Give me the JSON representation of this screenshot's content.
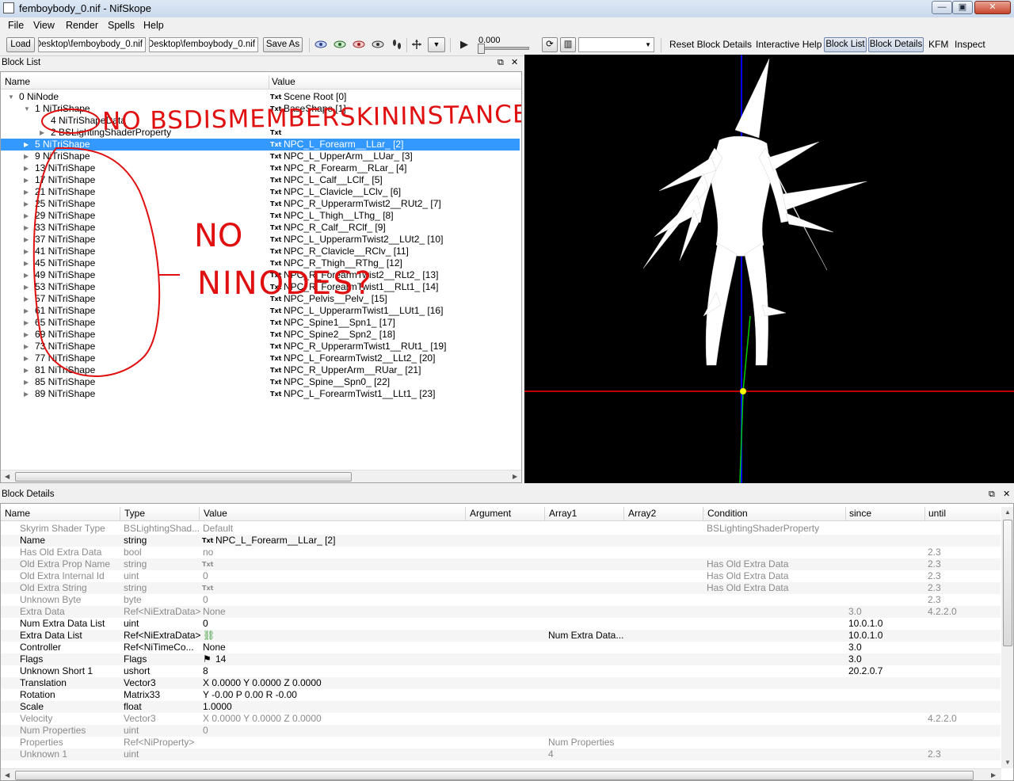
{
  "window": {
    "title": "femboybody_0.nif - NifSkope",
    "min_glyph": "—",
    "max_glyph": "▣",
    "close_glyph": "✕"
  },
  "menu": [
    "File",
    "View",
    "Render",
    "Spells",
    "Help"
  ],
  "toolbar": {
    "load_label": "Load",
    "load_path": "Desktop\\femboybody_0.nif",
    "save_path": "Desktop\\femboybody_0.nif",
    "save_as_label": "Save As",
    "view_icons": [
      "eye-icon",
      "eye-green-icon",
      "eye-red-icon",
      "eye-dark-icon",
      "eye-closed-icon",
      "footprints-icon"
    ],
    "play_glyph": "▶",
    "time_value": "0.000",
    "anim_select_value": "",
    "reset_label": "Reset Block Details",
    "help_label": "Interactive Help",
    "block_list_label": "Block List",
    "block_details_label": "Block Details",
    "kfm_label": "KFM",
    "inspect_label": "Inspect"
  },
  "block_list": {
    "title": "Block List",
    "col_name": "Name",
    "col_value": "Value",
    "txt_tag": "Txt",
    "rows": [
      {
        "indent": 0,
        "expanded": true,
        "name": "0 NiNode",
        "value": "Scene Root [0]",
        "txt": true,
        "selected": false
      },
      {
        "indent": 1,
        "expanded": true,
        "name": "1 NiTriShape",
        "value": "BaseShape [1]",
        "txt": true,
        "selected": false
      },
      {
        "indent": 2,
        "expanded": null,
        "name": "4 NiTriShapeData",
        "value": "",
        "txt": false,
        "selected": false
      },
      {
        "indent": 2,
        "expanded": false,
        "name": "2 BSLightingShaderProperty",
        "value": "",
        "txt": true,
        "selected": false
      },
      {
        "indent": 1,
        "expanded": false,
        "name": "5 NiTriShape",
        "value": "NPC_L_Forearm__LLar_ [2]",
        "txt": true,
        "selected": true
      },
      {
        "indent": 1,
        "expanded": false,
        "name": "9 NiTriShape",
        "value": "NPC_L_UpperArm__LUar_ [3]",
        "txt": true,
        "selected": false
      },
      {
        "indent": 1,
        "expanded": false,
        "name": "13 NiTriShape",
        "value": "NPC_R_Forearm__RLar_ [4]",
        "txt": true,
        "selected": false
      },
      {
        "indent": 1,
        "expanded": false,
        "name": "17 NiTriShape",
        "value": "NPC_L_Calf__LClf_ [5]",
        "txt": true,
        "selected": false
      },
      {
        "indent": 1,
        "expanded": false,
        "name": "21 NiTriShape",
        "value": "NPC_L_Clavicle__LClv_ [6]",
        "txt": true,
        "selected": false
      },
      {
        "indent": 1,
        "expanded": false,
        "name": "25 NiTriShape",
        "value": "NPC_R_UpperarmTwist2__RUt2_ [7]",
        "txt": true,
        "selected": false
      },
      {
        "indent": 1,
        "expanded": false,
        "name": "29 NiTriShape",
        "value": "NPC_L_Thigh__LThg_ [8]",
        "txt": true,
        "selected": false
      },
      {
        "indent": 1,
        "expanded": false,
        "name": "33 NiTriShape",
        "value": "NPC_R_Calf__RClf_ [9]",
        "txt": true,
        "selected": false
      },
      {
        "indent": 1,
        "expanded": false,
        "name": "37 NiTriShape",
        "value": "NPC_L_UpperarmTwist2__LUt2_ [10]",
        "txt": true,
        "selected": false
      },
      {
        "indent": 1,
        "expanded": false,
        "name": "41 NiTriShape",
        "value": "NPC_R_Clavicle__RClv_ [11]",
        "txt": true,
        "selected": false
      },
      {
        "indent": 1,
        "expanded": false,
        "name": "45 NiTriShape",
        "value": "NPC_R_Thigh__RThg_ [12]",
        "txt": true,
        "selected": false
      },
      {
        "indent": 1,
        "expanded": false,
        "name": "49 NiTriShape",
        "value": "NPC_R_ForearmTwist2__RLt2_ [13]",
        "txt": true,
        "selected": false
      },
      {
        "indent": 1,
        "expanded": false,
        "name": "53 NiTriShape",
        "value": "NPC_R_ForearmTwist1__RLt1_ [14]",
        "txt": true,
        "selected": false
      },
      {
        "indent": 1,
        "expanded": false,
        "name": "57 NiTriShape",
        "value": "NPC_Pelvis__Pelv_ [15]",
        "txt": true,
        "selected": false
      },
      {
        "indent": 1,
        "expanded": false,
        "name": "61 NiTriShape",
        "value": "NPC_L_UpperarmTwist1__LUt1_ [16]",
        "txt": true,
        "selected": false
      },
      {
        "indent": 1,
        "expanded": false,
        "name": "65 NiTriShape",
        "value": "NPC_Spine1__Spn1_ [17]",
        "txt": true,
        "selected": false
      },
      {
        "indent": 1,
        "expanded": false,
        "name": "69 NiTriShape",
        "value": "NPC_Spine2__Spn2_ [18]",
        "txt": true,
        "selected": false
      },
      {
        "indent": 1,
        "expanded": false,
        "name": "73 NiTriShape",
        "value": "NPC_R_UpperarmTwist1__RUt1_ [19]",
        "txt": true,
        "selected": false
      },
      {
        "indent": 1,
        "expanded": false,
        "name": "77 NiTriShape",
        "value": "NPC_L_ForearmTwist2__LLt2_ [20]",
        "txt": true,
        "selected": false
      },
      {
        "indent": 1,
        "expanded": false,
        "name": "81 NiTriShape",
        "value": "NPC_R_UpperArm__RUar_ [21]",
        "txt": true,
        "selected": false
      },
      {
        "indent": 1,
        "expanded": false,
        "name": "85 NiTriShape",
        "value": "NPC_Spine__Spn0_ [22]",
        "txt": true,
        "selected": false
      },
      {
        "indent": 1,
        "expanded": false,
        "name": "89 NiTriShape",
        "value": "NPC_L_ForearmTwist1__LLt1_ [23]",
        "txt": true,
        "selected": false
      }
    ]
  },
  "annotations": {
    "top_note": "NO BSDISMEMBERSKININSTANCE",
    "side_note_line1": "NO",
    "side_note_line2": "NINODES?",
    "color": "#e01010"
  },
  "viewport": {
    "background": "#000000",
    "axis_x_color": "#ff0000",
    "axis_y_color": "#00cc00",
    "axis_z_color": "#0000ff",
    "origin_color": "#ffff00",
    "mesh_color": "#ffffff"
  },
  "block_details": {
    "title": "Block Details",
    "columns": [
      "Name",
      "Type",
      "Value",
      "Argument",
      "Array1",
      "Array2",
      "Condition",
      "since",
      "until"
    ],
    "txt_tag": "Txt",
    "rows": [
      {
        "name": "Skyrim Shader Type",
        "type": "BSLightingShad...",
        "value": "Default",
        "txt": false,
        "icon": "",
        "array1": "",
        "condition": "BSLightingShaderProperty",
        "since": "",
        "until": "",
        "dim": true
      },
      {
        "name": "Name",
        "type": "string",
        "value": "NPC_L_Forearm__LLar_ [2]",
        "txt": true,
        "icon": "",
        "array1": "",
        "condition": "",
        "since": "",
        "until": "",
        "dim": false
      },
      {
        "name": "Has Old Extra Data",
        "type": "bool",
        "value": "no",
        "txt": false,
        "icon": "",
        "array1": "",
        "condition": "",
        "since": "",
        "until": "2.3",
        "dim": true
      },
      {
        "name": "Old Extra Prop Name",
        "type": "string",
        "value": "",
        "txt": true,
        "icon": "",
        "array1": "",
        "condition": "Has Old Extra Data",
        "since": "",
        "until": "2.3",
        "dim": true
      },
      {
        "name": "Old Extra Internal Id",
        "type": "uint",
        "value": "0",
        "txt": false,
        "icon": "",
        "array1": "",
        "condition": "Has Old Extra Data",
        "since": "",
        "until": "2.3",
        "dim": true
      },
      {
        "name": "Old Extra String",
        "type": "string",
        "value": "",
        "txt": true,
        "icon": "",
        "array1": "",
        "condition": "Has Old Extra Data",
        "since": "",
        "until": "2.3",
        "dim": true
      },
      {
        "name": "Unknown Byte",
        "type": "byte",
        "value": "0",
        "txt": false,
        "icon": "",
        "array1": "",
        "condition": "",
        "since": "",
        "until": "2.3",
        "dim": true
      },
      {
        "name": "Extra Data",
        "type": "Ref<NiExtraData>",
        "value": "None",
        "txt": false,
        "icon": "",
        "array1": "",
        "condition": "",
        "since": "3.0",
        "until": "4.2.2.0",
        "dim": true
      },
      {
        "name": "Num Extra Data List",
        "type": "uint",
        "value": "0",
        "txt": false,
        "icon": "",
        "array1": "",
        "condition": "",
        "since": "10.0.1.0",
        "until": "",
        "dim": false
      },
      {
        "name": "Extra Data List",
        "type": "Ref<NiExtraData>",
        "value": "",
        "txt": false,
        "icon": "link",
        "array1": "Num Extra Data...",
        "condition": "",
        "since": "10.0.1.0",
        "until": "",
        "dim": false
      },
      {
        "name": "Controller",
        "type": "Ref<NiTimeCo...",
        "value": "None",
        "txt": false,
        "icon": "",
        "array1": "",
        "condition": "",
        "since": "3.0",
        "until": "",
        "dim": false
      },
      {
        "name": "Flags",
        "type": "Flags",
        "value": "14",
        "txt": false,
        "icon": "flag",
        "array1": "",
        "condition": "",
        "since": "3.0",
        "until": "",
        "dim": false
      },
      {
        "name": "Unknown Short 1",
        "type": "ushort",
        "value": "8",
        "txt": false,
        "icon": "",
        "array1": "",
        "condition": "",
        "since": "20.2.0.7",
        "until": "",
        "dim": false
      },
      {
        "name": "Translation",
        "type": "Vector3",
        "value": "X 0.0000 Y 0.0000 Z 0.0000",
        "txt": false,
        "icon": "",
        "array1": "",
        "condition": "",
        "since": "",
        "until": "",
        "dim": false
      },
      {
        "name": "Rotation",
        "type": "Matrix33",
        "value": "Y -0.00 P 0.00 R -0.00",
        "txt": false,
        "icon": "",
        "array1": "",
        "condition": "",
        "since": "",
        "until": "",
        "dim": false
      },
      {
        "name": "Scale",
        "type": "float",
        "value": "1.0000",
        "txt": false,
        "icon": "",
        "array1": "",
        "condition": "",
        "since": "",
        "until": "",
        "dim": false
      },
      {
        "name": "Velocity",
        "type": "Vector3",
        "value": "X 0.0000 Y 0.0000 Z 0.0000",
        "txt": false,
        "icon": "",
        "array1": "",
        "condition": "",
        "since": "",
        "until": "4.2.2.0",
        "dim": true
      },
      {
        "name": "Num Properties",
        "type": "uint",
        "value": "0",
        "txt": false,
        "icon": "",
        "array1": "",
        "condition": "",
        "since": "",
        "until": "",
        "dim": true
      },
      {
        "name": "Properties",
        "type": "Ref<NiProperty>",
        "value": "",
        "txt": false,
        "icon": "",
        "array1": "Num Properties",
        "condition": "",
        "since": "",
        "until": "",
        "dim": true
      },
      {
        "name": "Unknown 1",
        "type": "uint",
        "value": "",
        "txt": false,
        "icon": "",
        "array1": "4",
        "condition": "",
        "since": "",
        "until": "2.3",
        "dim": true
      }
    ]
  }
}
